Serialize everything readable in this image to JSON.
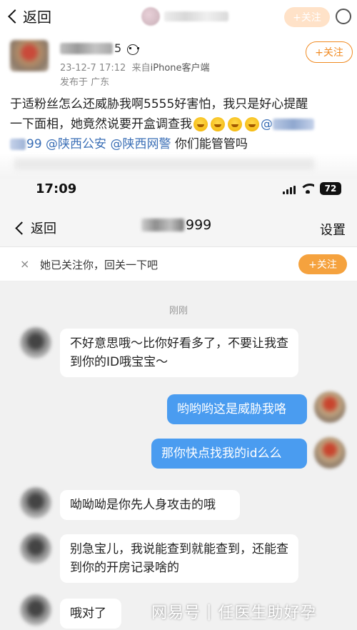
{
  "topbar": {
    "back_label": "返回",
    "follow_label": "+关注"
  },
  "post": {
    "name_suffix": "5",
    "date": "23-12-7 17:12",
    "source_prefix": "来自",
    "source": "iPhone客户端",
    "location": "发布于 广东",
    "follow_label": "+关注",
    "text_line1": "于适粉丝怎么还威胁我啊5555好害怕，我只是好心提醒",
    "text_line2": "一下面相，她竟然说要开盒调查我",
    "mention_at": "@",
    "text_line3_partial": "99",
    "mentions": [
      "@陕西公安",
      "@陕西网警"
    ],
    "text_tail": "你们能管管吗"
  },
  "phone": {
    "time": "17:09",
    "battery": "72",
    "back_label": "返回",
    "chat_title_suffix": "999",
    "settings_label": "设置",
    "banner_text": "她已关注你，回关一下吧",
    "banner_close": "×",
    "banner_button": "+关注",
    "timestamp": "刚刚",
    "messages": [
      {
        "side": "in",
        "text": "不好意思哦～比你好看多了，不要让我查到你的ID哦宝宝～"
      },
      {
        "side": "out",
        "text": "哟哟哟这是威胁我咯"
      },
      {
        "side": "out",
        "text": "那你快点找我的id么么"
      },
      {
        "side": "in",
        "text": "呦呦呦是你先人身攻击的哦"
      },
      {
        "side": "in",
        "text": "别急宝儿，我说能查到就能查到，还能查到你的开房记录啥的"
      },
      {
        "side": "in",
        "text": "哦对了"
      }
    ]
  },
  "watermark": {
    "platform": "网易号",
    "separator": "|",
    "account": "任医生助好孕"
  }
}
